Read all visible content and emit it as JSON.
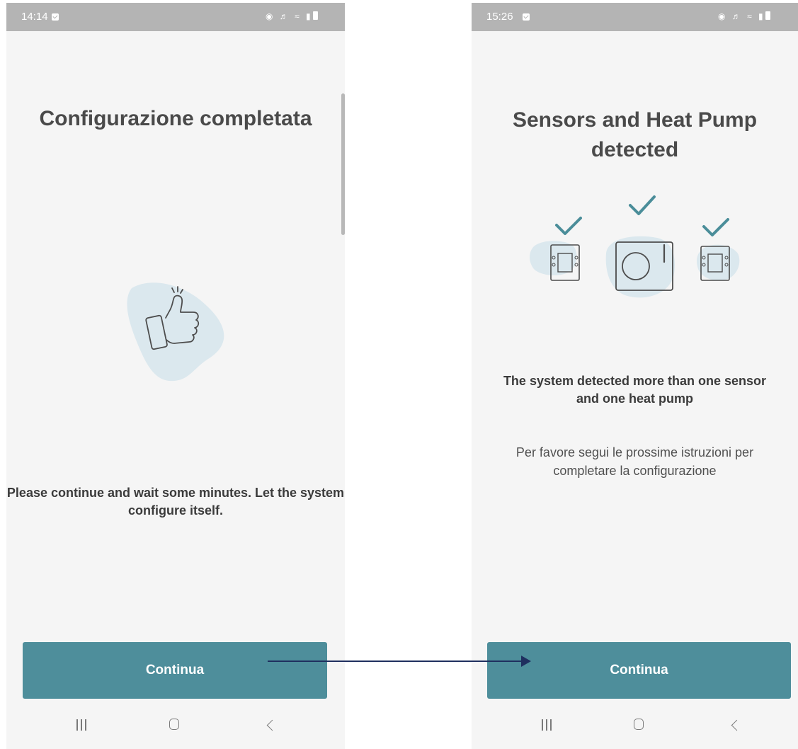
{
  "left_screen": {
    "status_time": "14:14",
    "title": "Configurazione completata",
    "message": "Please continue and wait some minutes. Let the system configure itself.",
    "button_label": "Continua",
    "illustration_icon": "thumbs-up-icon"
  },
  "right_screen": {
    "status_time": "15:26",
    "title": "Sensors and Heat Pump detected",
    "message_bold": "The system detected more than one sensor and one heat pump",
    "message": "Per favore segui le prossime istruzioni per completare la configurazione",
    "button_label": "Continua",
    "illustration_icons": [
      "sensor-icon",
      "heat-pump-icon",
      "sensor-icon"
    ]
  },
  "colors": {
    "accent": "#4e8e9b",
    "blob": "#dbe8ee",
    "check": "#4a8d99",
    "status_bar": "#b4b4b4",
    "background": "#f5f5f5",
    "arrow": "#1f2f5f"
  }
}
